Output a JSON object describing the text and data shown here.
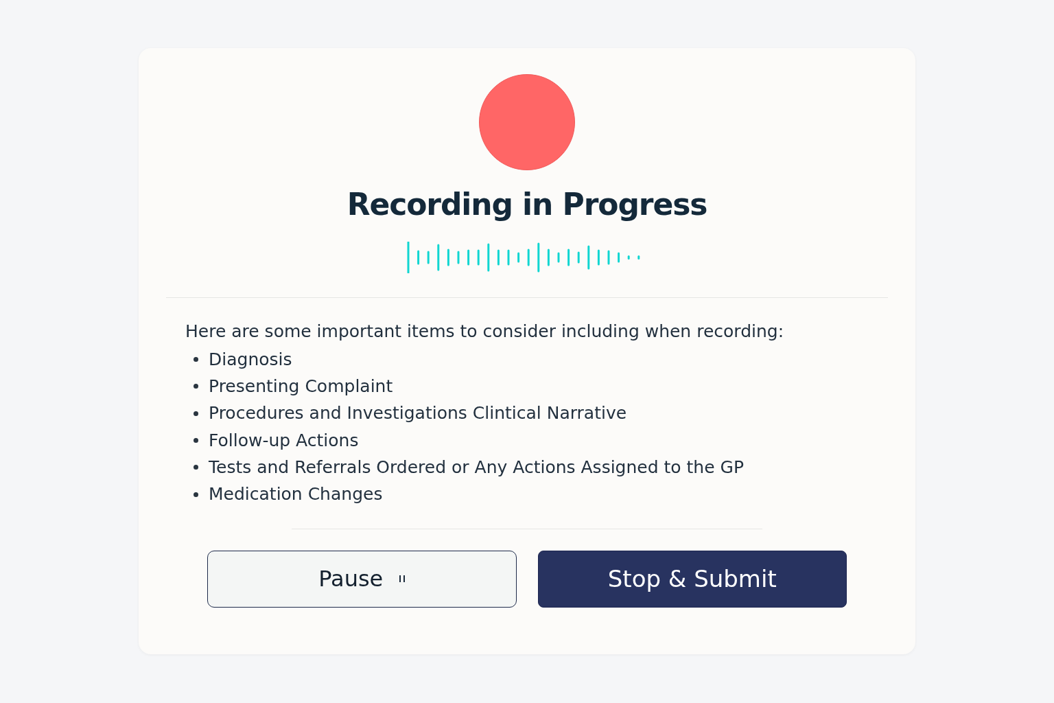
{
  "title": "Recording in Progress",
  "intro": "Here are some important items to consider including when recording:",
  "items": [
    "Diagnosis",
    "Presenting Complaint",
    "Procedures and Investigations Clintical Narrative",
    "Follow-up Actions",
    "Tests and Referrals Ordered or Any Actions Assigned to the GP",
    "Medication Changes"
  ],
  "buttons": [
    {
      "label": "Pause",
      "kind": "secondary"
    },
    {
      "label": "Stop & Submit",
      "kind": "primary"
    }
  ]
}
